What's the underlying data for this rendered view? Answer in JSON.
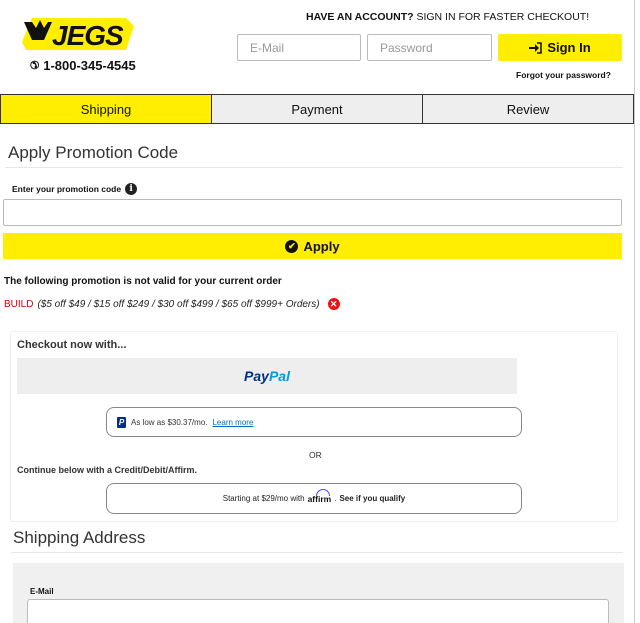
{
  "brand": {
    "logo_text": "JEGS",
    "phone": "1-800-345-4545"
  },
  "account": {
    "prompt_bold": "HAVE AN ACCOUNT?",
    "prompt_rest": " SIGN IN FOR FASTER CHECKOUT!",
    "email_placeholder": "E-Mail",
    "password_placeholder": "Password",
    "signin_label": "Sign In",
    "forgot_label": "Forgot your password?"
  },
  "tabs": [
    {
      "label": "Shipping",
      "active": true
    },
    {
      "label": "Payment",
      "active": false
    },
    {
      "label": "Review",
      "active": false
    }
  ],
  "promo": {
    "title": "Apply Promotion Code",
    "field_label": "Enter your promotion code",
    "input_value": "",
    "apply_label": "Apply",
    "invalid_message": "The following promotion is not valid for your current order",
    "code": "BUILD",
    "description": "($5 off $49 / $15 off $249 / $30 off $499 / $65 off $999+ Orders)"
  },
  "checkout": {
    "heading": "Checkout now with...",
    "paypal_pay": "Pay",
    "paypal_pal": "Pal",
    "paylater_text": "As low as $30.37/mo.",
    "paylater_link": "Learn more",
    "or_text": "OR",
    "continue_text": "Continue below with a Credit/Debit/Affirm.",
    "affirm_prefix": "Starting at $29/mo with",
    "affirm_brand": "affirm",
    "affirm_link": "See if you qualify"
  },
  "shipping": {
    "title": "Shipping Address",
    "email_label": "E-Mail",
    "email_value": ""
  },
  "colors": {
    "accent": "#ffee00",
    "error": "#dd1111",
    "paypal_dark": "#003087",
    "paypal_light": "#009cde"
  }
}
